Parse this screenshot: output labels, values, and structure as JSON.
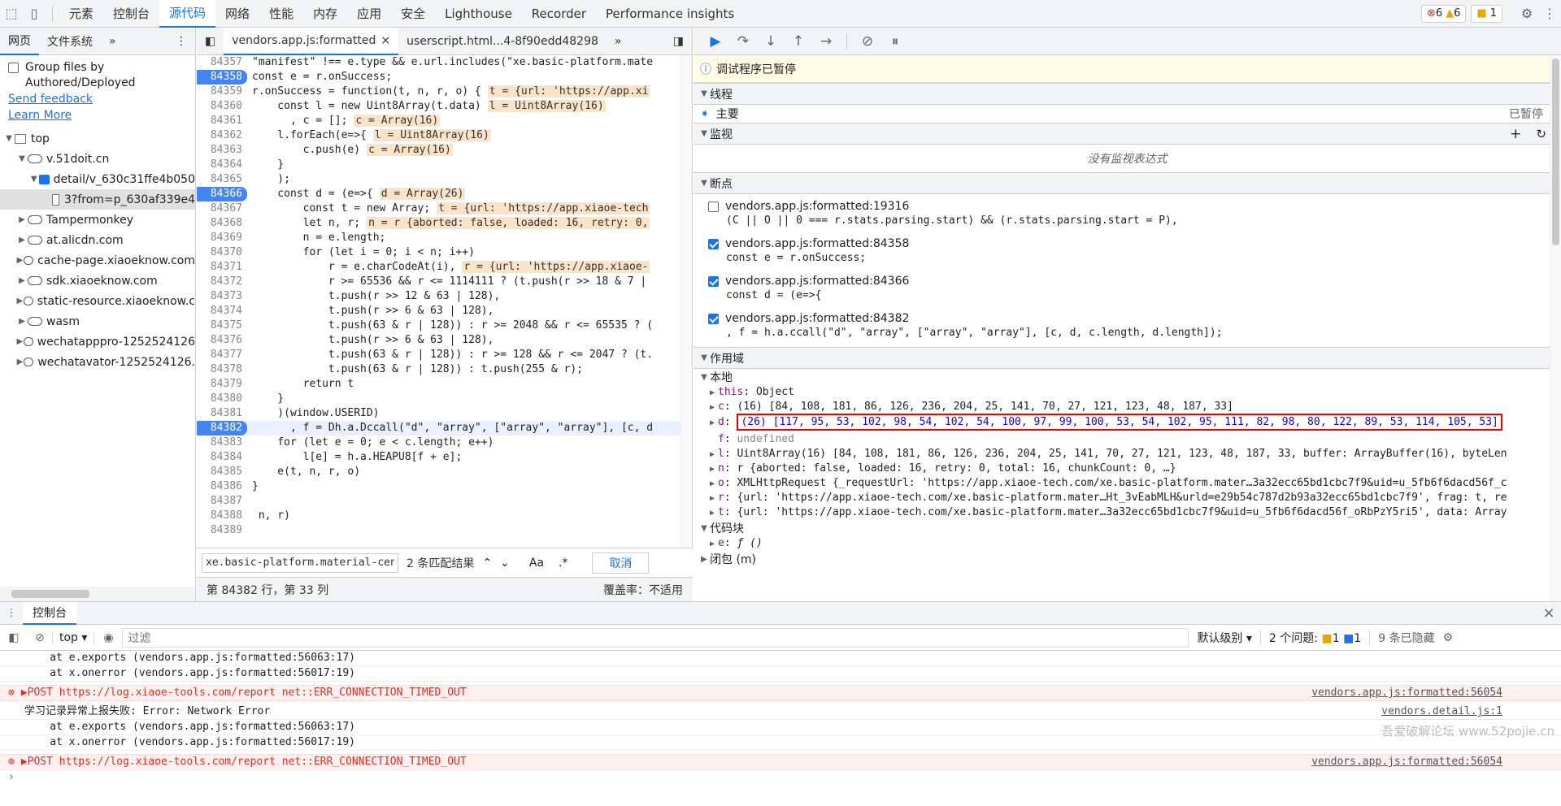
{
  "topbar": {
    "tabs": [
      "元素",
      "控制台",
      "源代码",
      "网络",
      "性能",
      "内存",
      "应用",
      "安全",
      "Lighthouse",
      "Recorder",
      "Performance insights"
    ],
    "active_tab": "源代码",
    "errors": "6",
    "warnings": "6",
    "issues": "1"
  },
  "leftnav": {
    "tabs": [
      "网页",
      "文件系统"
    ],
    "group_files": "Group files by Authored/Deployed",
    "send_feedback": "Send feedback",
    "learn_more": "Learn More",
    "tree": [
      {
        "label": "top",
        "level": 0,
        "type": "frame",
        "open": true
      },
      {
        "label": "v.51doit.cn",
        "level": 1,
        "type": "cloud",
        "open": true
      },
      {
        "label": "detail/v_630c31ffe4b050",
        "level": 2,
        "type": "folder",
        "open": true
      },
      {
        "label": "3?from=p_630af339e4",
        "level": 3,
        "type": "file",
        "selected": true
      },
      {
        "label": "Tampermonkey",
        "level": 1,
        "type": "cloud"
      },
      {
        "label": "at.alicdn.com",
        "level": 1,
        "type": "cloud"
      },
      {
        "label": "cache-page.xiaoeknow.com",
        "level": 1,
        "type": "cloud"
      },
      {
        "label": "sdk.xiaoeknow.com",
        "level": 1,
        "type": "cloud"
      },
      {
        "label": "static-resource.xiaoeknow.c",
        "level": 1,
        "type": "cloud"
      },
      {
        "label": "wasm",
        "level": 1,
        "type": "cloud"
      },
      {
        "label": "wechatapppro-1252524126",
        "level": 1,
        "type": "cloud"
      },
      {
        "label": "wechatavator-1252524126.",
        "level": 1,
        "type": "cloud"
      }
    ]
  },
  "editor": {
    "file_tabs": [
      "vendors.app.js:formatted",
      "userscript.html...4-8f90edd48298"
    ],
    "lines": [
      {
        "n": "84357",
        "t": "\"manifest\" !== e.type && e.url.includes(\"xe.basic-platform.mate"
      },
      {
        "n": "84358",
        "t": "const e = r.onSuccess;",
        "bp": true
      },
      {
        "n": "84359",
        "t": "r.onSuccess = function(t, n, r, o) {",
        "iv": "t = {url: 'https://app.xi"
      },
      {
        "n": "84360",
        "t": "    const l = new Uint8Array(t.data)",
        "iv": "l = Uint8Array(16)"
      },
      {
        "n": "84361",
        "t": "      , c = [];",
        "iv": "c = Array(16)"
      },
      {
        "n": "84362",
        "t": "    l.forEach(e=>{",
        "iv": "l = Uint8Array(16)"
      },
      {
        "n": "84363",
        "t": "        c.push(e)",
        "iv": "c = Array(16)"
      },
      {
        "n": "84364",
        "t": "    }"
      },
      {
        "n": "84365",
        "t": "    );"
      },
      {
        "n": "84366",
        "t": "    const d = (e=>{",
        "iv": "d = Array(26)",
        "bp": true
      },
      {
        "n": "84367",
        "t": "        const t = new Array;",
        "iv": "t = {url: 'https://app.xiaoe-tech"
      },
      {
        "n": "84368",
        "t": "        let n, r;",
        "iv": "n = r {aborted: false, loaded: 16, retry: 0,"
      },
      {
        "n": "84369",
        "t": "        n = e.length;"
      },
      {
        "n": "84370",
        "t": "        for (let i = 0; i < n; i++)"
      },
      {
        "n": "84371",
        "t": "            r = e.charCodeAt(i),",
        "iv": "r = {url: 'https://app.xiaoe-"
      },
      {
        "n": "84372",
        "t": "            r >= 65536 && r <= 1114111 ? (t.push(r >> 18 & 7 | "
      },
      {
        "n": "84373",
        "t": "            t.push(r >> 12 & 63 | 128),"
      },
      {
        "n": "84374",
        "t": "            t.push(r >> 6 & 63 | 128),"
      },
      {
        "n": "84375",
        "t": "            t.push(63 & r | 128)) : r >= 2048 && r <= 65535 ? ("
      },
      {
        "n": "84376",
        "t": "            t.push(r >> 6 & 63 | 128),"
      },
      {
        "n": "84377",
        "t": "            t.push(63 & r | 128)) : r >= 128 && r <= 2047 ? (t."
      },
      {
        "n": "84378",
        "t": "            t.push(63 & r | 128)) : t.push(255 & r);"
      },
      {
        "n": "84379",
        "t": "        return t"
      },
      {
        "n": "84380",
        "t": "    }"
      },
      {
        "n": "84381",
        "t": "    )(window.USERID)"
      },
      {
        "n": "84382",
        "t": "      , f = Dh.a.Dccall(\"d\", \"array\", [\"array\", \"array\"], [c, d",
        "bp": true,
        "cur": true
      },
      {
        "n": "84383",
        "t": "    for (let e = 0; e < c.length; e++)"
      },
      {
        "n": "84384",
        "t": "        l[e] = h.a.HEAPU8[f + e];"
      },
      {
        "n": "84385",
        "t": "    e(t, n, r, o)"
      },
      {
        "n": "84386",
        "t": "}"
      },
      {
        "n": "84387",
        "t": ""
      },
      {
        "n": "84388",
        "t": " n, r)"
      },
      {
        "n": "84389",
        "t": ""
      }
    ],
    "search_value": "xe.basic-platform.material-center.d",
    "search_matches": "2 条匹配结果",
    "search_case": "Aa",
    "search_regex": ".*",
    "search_cancel": "取消",
    "status_pos": "第 84382 行，第 33 列",
    "status_coverage": "覆盖率：不适用"
  },
  "debugger": {
    "paused_label": "调试程序已暂停",
    "threads_title": "线程",
    "thread_main": "主要",
    "thread_status": "已暂停",
    "watch_title": "监视",
    "watch_empty": "没有监视表达式",
    "breakpoints_title": "断点",
    "breakpoints": [
      {
        "file": "vendors.app.js:formatted:19316",
        "code": "(C || O || 0 === r.stats.parsing.start) && (r.stats.parsing.start = P),",
        "checked": false
      },
      {
        "file": "vendors.app.js:formatted:84358",
        "code": "const e = r.onSuccess;",
        "checked": true
      },
      {
        "file": "vendors.app.js:formatted:84366",
        "code": "const d = (e=>{",
        "checked": true
      },
      {
        "file": "vendors.app.js:formatted:84382",
        "code": ", f = h.a.ccall(\"d\", \"array\", [\"array\", \"array\"], [c, d, c.length, d.length]);",
        "checked": true
      }
    ],
    "scope_title": "作用域",
    "local_title": "本地",
    "scope_props": [
      {
        "k": "this",
        "v": "Object"
      },
      {
        "k": "c",
        "v": "(16) [84, 108, 181, 86, 126, 236, 204, 25, 141, 70, 27, 121, 123, 48, 187, 33]"
      },
      {
        "k": "d",
        "v": "(26) [117, 95, 53, 102, 98, 54, 102, 54, 100, 97, 99, 100, 53, 54, 102, 95, 111, 82, 98, 80, 122, 89, 53, 114, 105, 53]",
        "boxed": true
      },
      {
        "k": "f",
        "v": "undefined",
        "noexp": true
      },
      {
        "k": "l",
        "v": "Uint8Array(16) [84, 108, 181, 86, 126, 236, 204, 25, 141, 70, 27, 121, 123, 48, 187, 33, buffer: ArrayBuffer(16), byteLen"
      },
      {
        "k": "n",
        "v": "r {aborted: false, loaded: 16, retry: 0, total: 16, chunkCount: 0, …}"
      },
      {
        "k": "o",
        "v": "XMLHttpRequest {_requestUrl: 'https://app.xiaoe-tech.com/xe.basic-platform.mater…3a32ecc65bd1cbc7f9&uid=u_5fb6f6dacd56f_c"
      },
      {
        "k": "r",
        "v": "{url: 'https://app.xiaoe-tech.com/xe.basic-platform.mater…Ht_3vEabMLH&urld=e29b54c787d2b93a32ecc65bd1cbc7f9', frag: t, re"
      },
      {
        "k": "t",
        "v": "{url: 'https://app.xiaoe-tech.com/xe.basic-platform.mater…3a32ecc65bd1cbc7f9&uid=u_5fb6f6dacd56f_oRbPzY5ri5', data: Array"
      }
    ],
    "block_title": "代码块",
    "block_prop": {
      "k": "e",
      "v": "ƒ ()"
    },
    "closure_title": "闭包 (m)"
  },
  "console": {
    "title": "控制台",
    "context": "top",
    "filter_placeholder": "过滤",
    "level": "默认级别",
    "issues": "2 个问题:",
    "issues_warn": "1",
    "issues_info": "1",
    "hidden": "9 条已隐藏",
    "rows": [
      {
        "text": "    at e.exports (vendors.app.js:formatted:56063:17)",
        "type": "normal",
        "partial": true
      },
      {
        "text": "    at x.onerror (vendors.app.js:formatted:56017:19)",
        "type": "normal"
      },
      {
        "text": "▶POST https://log.xiaoe-tools.com/report net::ERR_CONNECTION_TIMED_OUT",
        "type": "err",
        "src": "vendors.app.js:formatted:56054"
      },
      {
        "text": "学习记录异常上报失败: Error: Network Error",
        "type": "normal",
        "src": "vendors.detail.js:1"
      },
      {
        "text": "    at e.exports (vendors.app.js:formatted:56063:17)",
        "type": "normal"
      },
      {
        "text": "    at x.onerror (vendors.app.js:formatted:56017:19)",
        "type": "normal"
      },
      {
        "text": "▶POST https://log.xiaoe-tools.com/report net::ERR_CONNECTION_TIMED_OUT",
        "type": "err",
        "src": "vendors.app.js:formatted:56054"
      }
    ],
    "prompt": "›"
  },
  "watermark": "吾爱破解论坛 www.52pojie.cn"
}
